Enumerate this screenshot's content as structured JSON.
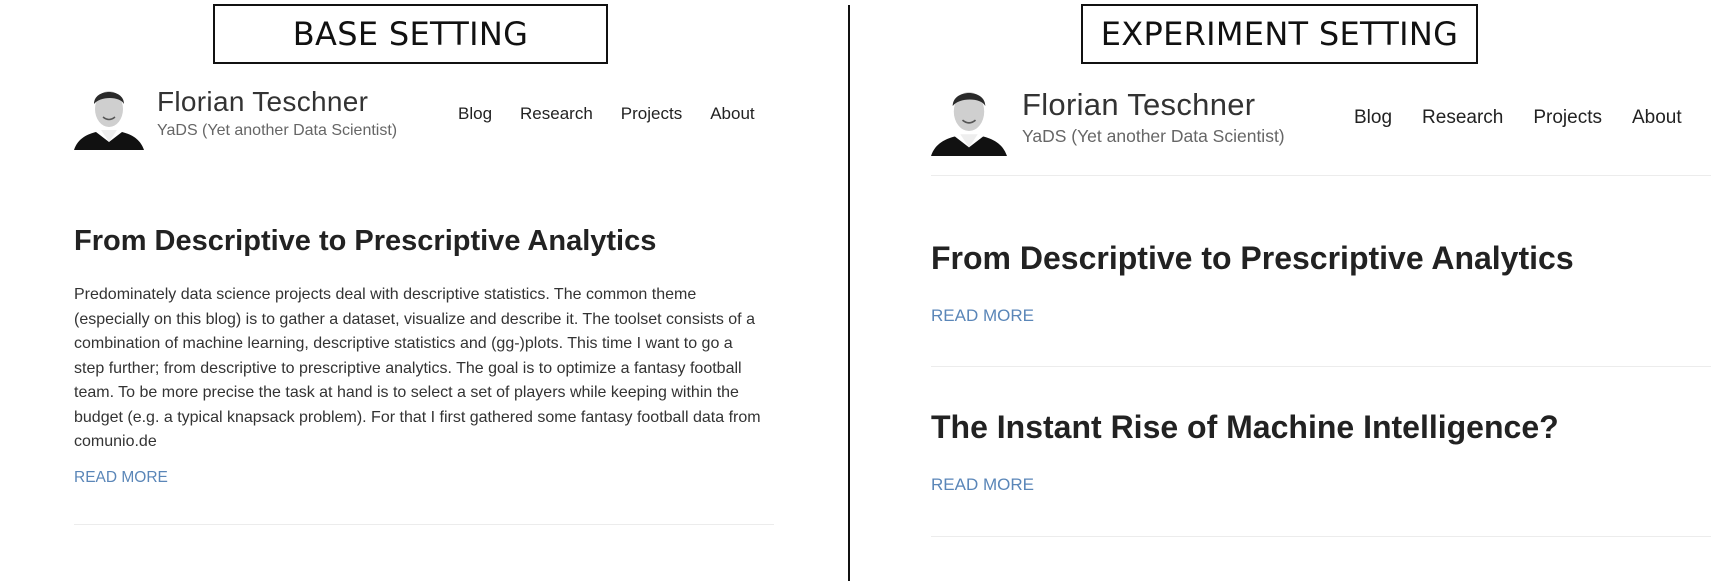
{
  "labels": {
    "base": "BASE SETTING",
    "experiment": "EXPERIMENT SETTING"
  },
  "site": {
    "title": "Florian Teschner",
    "subtitle": "YaDS (Yet another Data Scientist)",
    "nav": [
      "Blog",
      "Research",
      "Projects",
      "About"
    ]
  },
  "base": {
    "post": {
      "title": "From Descriptive to Prescriptive Analytics",
      "excerpt": "Predominately data science projects deal with descriptive statistics. The common theme (especially on this blog) is to gather a dataset, visualize and describe it. The toolset consists of a combination of machine learning, descriptive statistics and (gg-)plots. This time I want to go a step further; from descriptive to prescriptive analytics. The goal is to optimize a fantasy football team. To be more precise the task at hand is to select a set of players while keeping within the budget (e.g. a typical knapsack problem). For that I first gathered some fantasy football data from comunio.de",
      "read_more": "READ MORE"
    }
  },
  "experiment": {
    "posts": [
      {
        "title": "From Descriptive to Prescriptive Analytics",
        "read_more": "READ MORE"
      },
      {
        "title": "The Instant Rise of Machine Intelligence?",
        "read_more": "READ MORE"
      }
    ]
  },
  "colors": {
    "link": "#5a86b8",
    "divider": "#111111",
    "text": "#222222"
  }
}
